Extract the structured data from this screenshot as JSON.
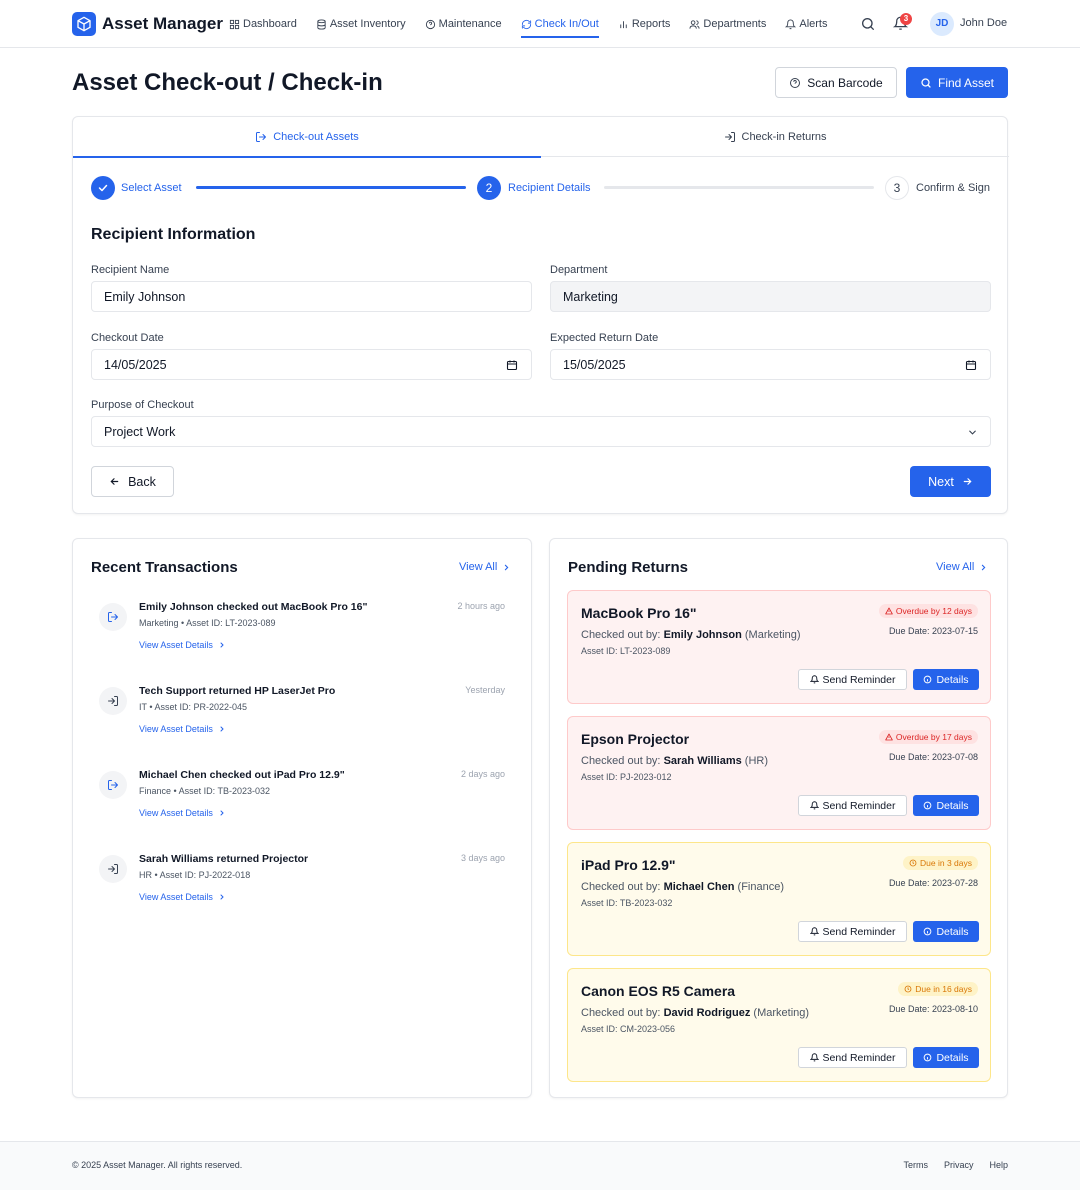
{
  "app": {
    "name": "Asset Manager",
    "brand_color": "#2563eb"
  },
  "nav": {
    "items": [
      {
        "label": "Dashboard",
        "icon": "grid-icon"
      },
      {
        "label": "Asset Inventory",
        "icon": "database-icon"
      },
      {
        "label": "Maintenance",
        "icon": "help-circle-icon"
      },
      {
        "label": "Check In/Out",
        "icon": "refresh-icon",
        "active": true
      },
      {
        "label": "Reports",
        "icon": "bar-chart-icon"
      },
      {
        "label": "Departments",
        "icon": "users-icon"
      },
      {
        "label": "Alerts",
        "icon": "bell-icon"
      }
    ],
    "notification_count": "3",
    "user_initials": "JD",
    "user_name": "John Doe"
  },
  "header": {
    "title": "Asset Check-out / Check-in",
    "scan_label": "Scan Barcode",
    "find_label": "Find Asset"
  },
  "tabs": {
    "checkout": "Check-out Assets",
    "checkin": "Check-in Returns"
  },
  "steps": [
    {
      "number": "1",
      "label": "Select Asset",
      "status": "complete"
    },
    {
      "number": "2",
      "label": "Recipient Details",
      "status": "current"
    },
    {
      "number": "3",
      "label": "Confirm & Sign",
      "status": "upcoming"
    }
  ],
  "form": {
    "section_title": "Recipient Information",
    "recipient_label": "Recipient Name",
    "recipient_value": "Emily Johnson",
    "department_label": "Department",
    "department_value": "Marketing",
    "checkout_label": "Checkout Date",
    "checkout_value": "14/05/2025",
    "return_label": "Expected Return Date",
    "return_value": "15/05/2025",
    "purpose_label": "Purpose of Checkout",
    "purpose_value": "Project Work",
    "back_label": "Back",
    "next_label": "Next"
  },
  "recent": {
    "title": "Recent Transactions",
    "view_all": "View All",
    "link_label": "View Asset Details",
    "items": [
      {
        "type": "checkout",
        "title": "Emily Johnson checked out MacBook Pro 16\"",
        "meta": "Marketing • Asset ID: LT-2023-089",
        "time": "2 hours ago"
      },
      {
        "type": "checkin",
        "title": "Tech Support returned HP LaserJet Pro",
        "meta": "IT • Asset ID: PR-2022-045",
        "time": "Yesterday"
      },
      {
        "type": "checkout",
        "title": "Michael Chen checked out iPad Pro 12.9\"",
        "meta": "Finance • Asset ID: TB-2023-032",
        "time": "2 days ago"
      },
      {
        "type": "checkin",
        "title": "Sarah Williams returned Projector",
        "meta": "HR • Asset ID: PJ-2022-018",
        "time": "3 days ago"
      }
    ]
  },
  "pending": {
    "title": "Pending Returns",
    "view_all": "View All",
    "by_prefix": "Checked out by:",
    "remind_label": "Send Reminder",
    "details_label": "Details",
    "items": [
      {
        "status": "overdue",
        "name": "MacBook Pro 16\"",
        "person": "Emily Johnson",
        "dept": "(Marketing)",
        "asset": "Asset ID: LT-2023-089",
        "badge": "Overdue by 12 days",
        "due": "Due Date: 2023-07-15"
      },
      {
        "status": "overdue",
        "name": "Epson Projector",
        "person": "Sarah Williams",
        "dept": "(HR)",
        "asset": "Asset ID: PJ-2023-012",
        "badge": "Overdue by 17 days",
        "due": "Due Date: 2023-07-08"
      },
      {
        "status": "due",
        "name": "iPad Pro 12.9\"",
        "person": "Michael Chen",
        "dept": "(Finance)",
        "asset": "Asset ID: TB-2023-032",
        "badge": "Due in 3 days",
        "due": "Due Date: 2023-07-28"
      },
      {
        "status": "due",
        "name": "Canon EOS R5 Camera",
        "person": "David Rodriguez",
        "dept": "(Marketing)",
        "asset": "Asset ID: CM-2023-056",
        "badge": "Due in 16 days",
        "due": "Due Date: 2023-08-10"
      }
    ]
  },
  "footer": {
    "copyright": "© 2025 Asset Manager. All rights reserved.",
    "links": [
      "Terms",
      "Privacy",
      "Help"
    ]
  }
}
